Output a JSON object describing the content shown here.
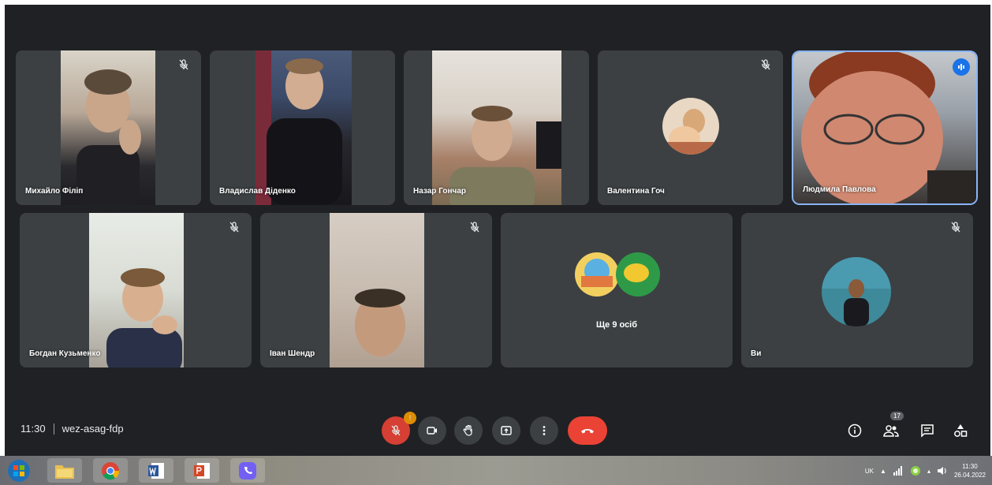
{
  "participants_row1": [
    {
      "name": "Михайло Філіп",
      "muted": true
    },
    {
      "name": "Владислав Діденко",
      "muted": false
    },
    {
      "name": "Назар Гончар",
      "muted": false
    },
    {
      "name": "Валентина Гоч",
      "muted": true
    },
    {
      "name": "Людмила Павлова",
      "muted": false,
      "speaking": true
    }
  ],
  "participants_row2": [
    {
      "name": "Богдан Кузьменко",
      "muted": true
    },
    {
      "name": "Іван Шендр",
      "muted": true
    },
    {
      "name": "",
      "more_label": "Ще 9 осіб"
    },
    {
      "name": "Ви",
      "muted": true
    }
  ],
  "meeting": {
    "time": "11:30",
    "code": "wez-asag-fdp",
    "people_count": "17",
    "mic_badge": "!"
  },
  "icons": {
    "mute": "mic-off-icon",
    "camera": "camera-icon",
    "hand": "raise-hand-icon",
    "present": "present-icon",
    "more": "more-vert-icon",
    "hangup": "hang-up-icon",
    "info": "info-icon",
    "people": "people-icon",
    "chat": "chat-icon",
    "activities": "activities-icon"
  },
  "taskbar": {
    "apps": [
      "start-orb",
      "file-explorer",
      "chrome",
      "word",
      "powerpoint",
      "viber"
    ],
    "language": "UK",
    "clock_time": "11:30",
    "clock_date": "26.04.2022"
  },
  "colors": {
    "background": "#202124",
    "tile": "#3c4043",
    "hangup": "#ea4335",
    "active_border": "#8ab4f8",
    "speaking": "#1a73e8"
  }
}
